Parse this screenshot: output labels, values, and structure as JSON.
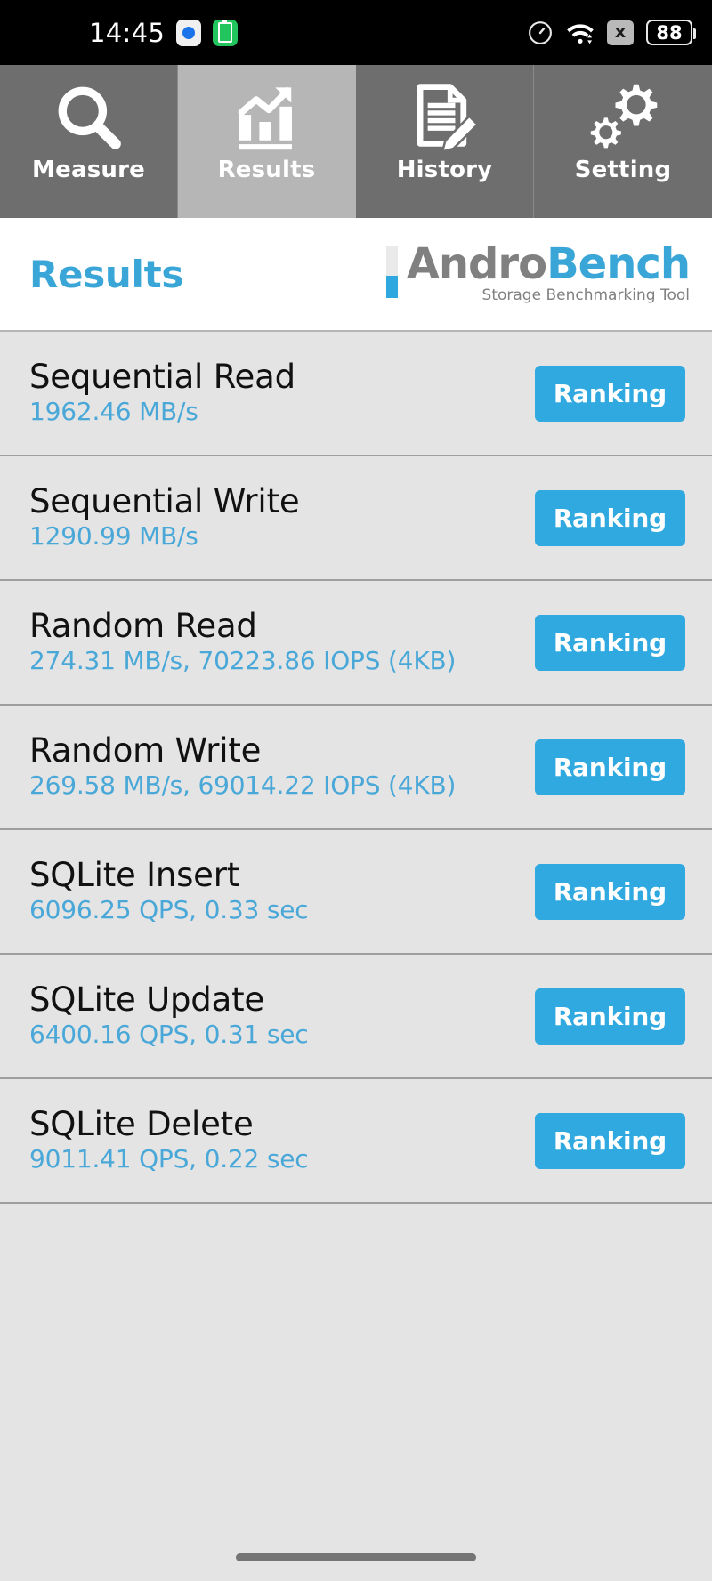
{
  "status_bar": {
    "clock": "14:45",
    "left_icons": [
      {
        "name": "media-indicator-icon",
        "glyph": "●"
      },
      {
        "name": "battery-saver-icon",
        "glyph": "▮"
      }
    ],
    "right_icons": [
      {
        "name": "speedometer-icon",
        "glyph": "◴"
      },
      {
        "name": "wifi-icon",
        "glyph": "▲"
      },
      {
        "name": "no-sim-icon",
        "glyph": "x"
      }
    ],
    "battery_percent": "88"
  },
  "tabs": [
    {
      "label": "Measure",
      "icon": "magnifier-icon",
      "active": false
    },
    {
      "label": "Results",
      "icon": "bar-chart-icon",
      "active": true
    },
    {
      "label": "History",
      "icon": "document-pencil-icon",
      "active": false
    },
    {
      "label": "Setting",
      "icon": "gears-icon",
      "active": false
    }
  ],
  "header": {
    "title": "Results",
    "logo": {
      "word_primary": "Andro",
      "word_secondary": "Bench",
      "tagline": "Storage Benchmarking Tool"
    }
  },
  "results": [
    {
      "title": "Sequential Read",
      "value": "1962.46 MB/s",
      "button": "Ranking"
    },
    {
      "title": "Sequential Write",
      "value": "1290.99 MB/s",
      "button": "Ranking"
    },
    {
      "title": "Random Read",
      "value": "274.31 MB/s, 70223.86 IOPS (4KB)",
      "button": "Ranking"
    },
    {
      "title": "Random Write",
      "value": "269.58 MB/s, 69014.22 IOPS (4KB)",
      "button": "Ranking"
    },
    {
      "title": "SQLite Insert",
      "value": "6096.25 QPS, 0.33 sec",
      "button": "Ranking"
    },
    {
      "title": "SQLite Update",
      "value": "6400.16 QPS, 0.31 sec",
      "button": "Ranking"
    },
    {
      "title": "SQLite Delete",
      "value": "9011.41 QPS, 0.22 sec",
      "button": "Ranking"
    }
  ],
  "colors": {
    "accent_blue": "#2fa9e0",
    "value_blue": "#4aa8d8",
    "title_blue": "#3aa6d8",
    "tab_inactive": "#6e6e6e",
    "tab_active": "#b6b6b6",
    "row_bg": "#e4e4e4",
    "logo_gray": "#808080"
  }
}
